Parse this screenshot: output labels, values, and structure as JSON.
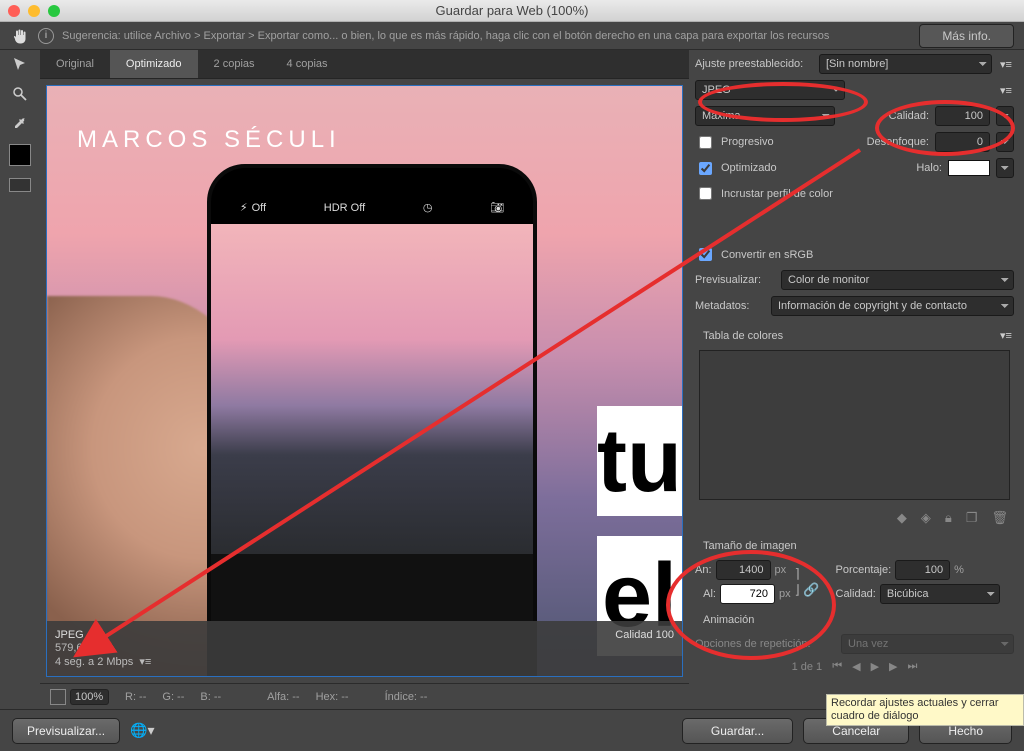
{
  "window": {
    "title": "Guardar para Web (100%)"
  },
  "hint": {
    "text": "Sugerencia: utilice Archivo > Exportar > Exportar como... o bien, lo que es más rápido, haga clic con el botón derecho en una capa para exportar los recursos",
    "more": "Más info."
  },
  "tabs": {
    "original": "Original",
    "optimizado": "Optimizado",
    "dos": "2 copias",
    "cuatro": "4 copias"
  },
  "preview": {
    "watermark": "MARCOS SÉCULI",
    "phoneFlash": "Off",
    "phoneHDR": "HDR Off",
    "big1": "tu",
    "big2": "el",
    "format": "JPEG",
    "size": "579,6 KB",
    "time": "4 seg. a 2 Mbps",
    "quality": "Calidad 100"
  },
  "settings": {
    "preset_label": "Ajuste preestablecido:",
    "preset_value": "[Sin nombre]",
    "format": "JPEG",
    "quality_preset": "Máxima",
    "quality_label": "Calidad:",
    "quality_value": "100",
    "progresivo": "Progresivo",
    "desenfoque_label": "Desenfoque:",
    "desenfoque_value": "0",
    "optimizado": "Optimizado",
    "halo_label": "Halo:",
    "perfil": "Incrustar perfil de color",
    "srgb": "Convertir en sRGB",
    "previsualizar_label": "Previsualizar:",
    "previsualizar_value": "Color de monitor",
    "metadatos_label": "Metadatos:",
    "metadatos_value": "Información de copyright y de contacto",
    "tabla": "Tabla de colores",
    "tam_title": "Tamaño de imagen",
    "an_label": "An:",
    "an_value": "1400",
    "al_label": "Al:",
    "al_value": "720",
    "px": "px",
    "pct_label": "Porcentaje:",
    "pct_value": "100",
    "pct_unit": "%",
    "cal_interp_label": "Calidad:",
    "cal_interp_value": "Bicúbica",
    "anim_title": "Animación",
    "rep_label": "Opciones de repetición:",
    "rep_value": "Una vez",
    "frame": "1 de 1"
  },
  "infobar": {
    "zoom": "100%",
    "r": "R: --",
    "g": "G: --",
    "b": "B: --",
    "alfa": "Alfa: --",
    "hex": "Hex: --",
    "indice": "Índice: --"
  },
  "footer": {
    "previsualizar": "Previsualizar...",
    "guardar": "Guardar...",
    "cancelar": "Cancelar",
    "hecho": "Hecho"
  },
  "tooltip": "Recordar ajustes actuales y cerrar cuadro de diálogo"
}
